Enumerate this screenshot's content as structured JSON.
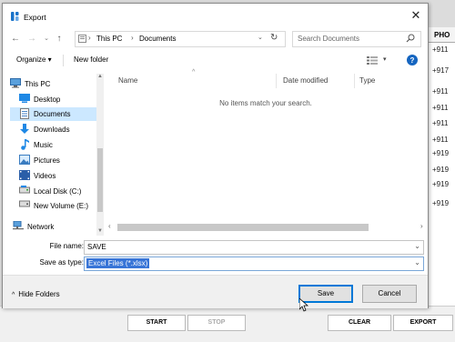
{
  "background": {
    "column_header": "PHO",
    "cells": [
      "+911",
      "+917",
      "+911",
      "+911",
      "+911",
      "+911",
      "+919",
      "+919",
      "+919",
      "+919"
    ],
    "buttons": {
      "start": "START",
      "stop": "STOP",
      "clear": "CLEAR",
      "export": "EXPORT"
    }
  },
  "dialog": {
    "title": "Export",
    "address": {
      "root": "This PC",
      "folder": "Documents"
    },
    "search_placeholder": "Search Documents",
    "toolbar": {
      "organize": "Organize ▾",
      "new_folder": "New folder"
    },
    "tree": {
      "this_pc": "This PC",
      "desktop": "Desktop",
      "documents": "Documents",
      "downloads": "Downloads",
      "music": "Music",
      "pictures": "Pictures",
      "videos": "Videos",
      "local_disk": "Local Disk (C:)",
      "new_volume": "New Volume (E:)",
      "network": "Network"
    },
    "columns": {
      "name": "Name",
      "date_modified": "Date modified",
      "type": "Type"
    },
    "empty_message": "No items match your search.",
    "file_name": {
      "label": "File name:",
      "value": "SAVE"
    },
    "save_as_type": {
      "label": "Save as type:",
      "value": "Excel Files (*.xlsx)"
    },
    "hide_folders": "Hide Folders",
    "save_button": "Save",
    "cancel_button": "Cancel"
  }
}
